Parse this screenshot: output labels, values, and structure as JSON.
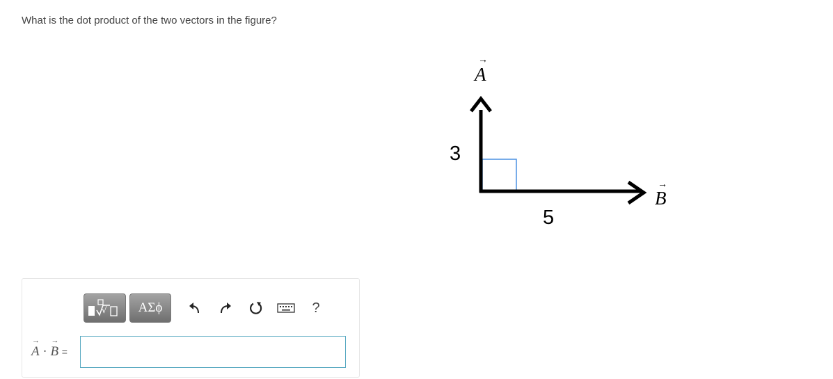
{
  "question": {
    "text": "What is the dot product of the two vectors in the figure?"
  },
  "figure": {
    "vector_a_label": "A",
    "vector_b_label": "B",
    "length_a_label": "3",
    "length_b_label": "5",
    "arrow_glyph": "→"
  },
  "toolbar": {
    "symbols_label": "ΑΣϕ",
    "help_label": "?"
  },
  "answer": {
    "lhs_a": "A",
    "lhs_dot": "·",
    "lhs_b": "B",
    "lhs_eq": "=",
    "value": ""
  },
  "colors": {
    "input_border": "#58a9c1",
    "right_angle_marker": "#4a90e2"
  }
}
